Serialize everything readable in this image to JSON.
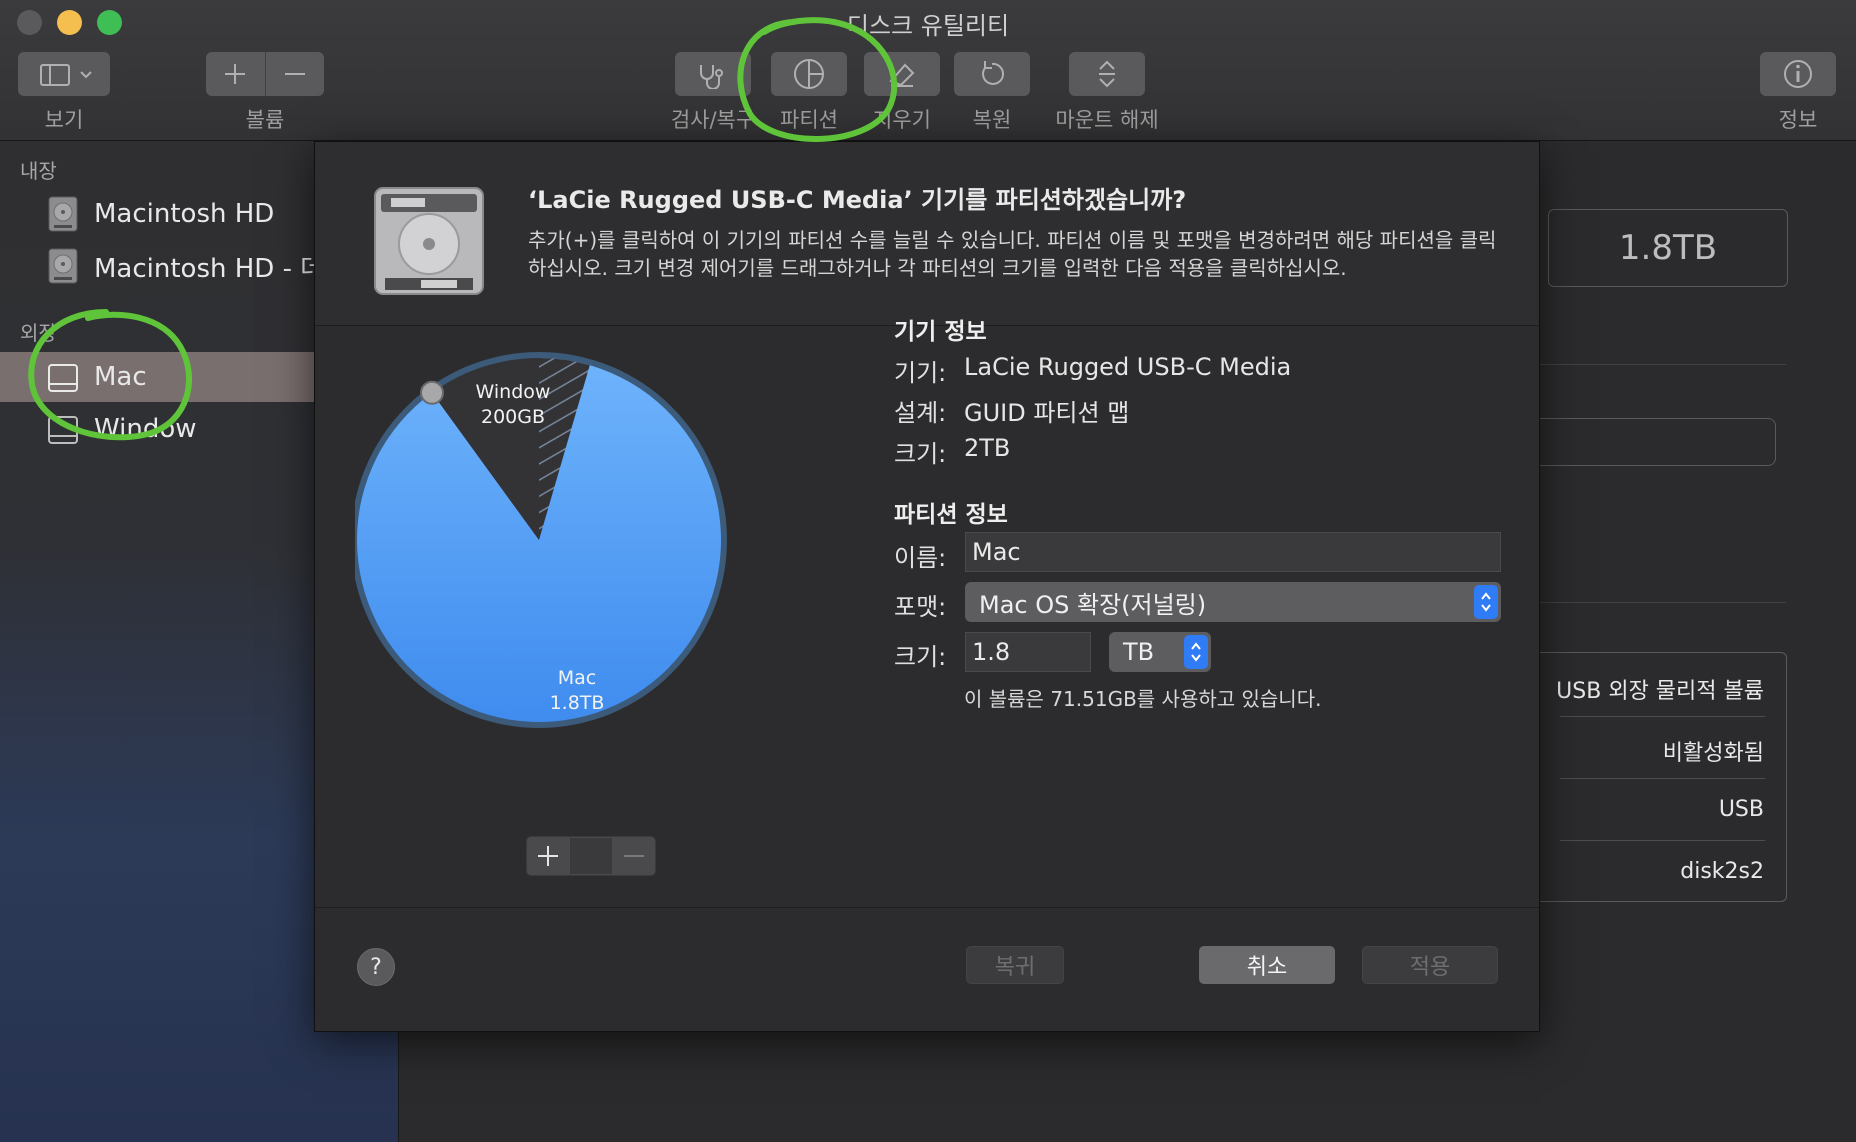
{
  "window": {
    "title": "디스크 유틸리티"
  },
  "toolbar": {
    "view_label": "보기",
    "volume_label": "볼륨",
    "firstaid_label": "검사/복구",
    "partition_label": "파티션",
    "erase_label": "지우기",
    "restore_label": "복원",
    "unmount_label": "마운트 해제",
    "info_label": "정보"
  },
  "sidebar": {
    "internal_header": "내장",
    "external_header": "외장",
    "internal_items": [
      {
        "label": "Macintosh HD"
      },
      {
        "label": "Macintosh HD - 데"
      }
    ],
    "external_items": [
      {
        "label": "Mac",
        "selected": true
      },
      {
        "label": "Window"
      }
    ]
  },
  "background_panel": {
    "capacity": "1.8TB",
    "details": [
      "USB 외장 물리적 볼륨",
      "비활성화됨",
      "USB",
      "disk2s2"
    ]
  },
  "sheet": {
    "title": "‘LaCie Rugged USB-C Media’ 기기를 파티션하겠습니까?",
    "description": "추가(+)를 클릭하여 이 기기의 파티션 수를 늘릴 수 있습니다. 파티션 이름 및 포맷을 변경하려면 해당 파티션을 클릭하십시오. 크기 변경 제어기를 드래그하거나 각 파티션의 크기를 입력한 다음 적용을 클릭하십시오.",
    "pie": {
      "partitions": [
        {
          "name": "Mac",
          "size": "1.8TB",
          "fraction": 0.9,
          "color": "#4a95f0"
        },
        {
          "name": "Window",
          "size": "200GB",
          "fraction": 0.1,
          "color": "#333336"
        }
      ]
    },
    "device_info": {
      "heading": "기기 정보",
      "device_label": "기기:",
      "device_value": "LaCie Rugged USB-C Media",
      "scheme_label": "설계:",
      "scheme_value": "GUID 파티션 맵",
      "size_label": "크기:",
      "size_value": "2TB"
    },
    "partition_info": {
      "heading": "파티션 정보",
      "name_label": "이름:",
      "name_value": "Mac",
      "format_label": "포맷:",
      "format_value": "Mac OS 확장(저널링)",
      "size_label": "크기:",
      "size_value": "1.8",
      "unit_value": "TB",
      "usage_note": "이 볼륨은 71.51GB를 사용하고 있습니다."
    },
    "buttons": {
      "revert": "복귀",
      "cancel": "취소",
      "apply": "적용",
      "help": "?"
    }
  },
  "colors": {
    "accent": "#2f7cf6",
    "annotation": "#5fc43a"
  }
}
